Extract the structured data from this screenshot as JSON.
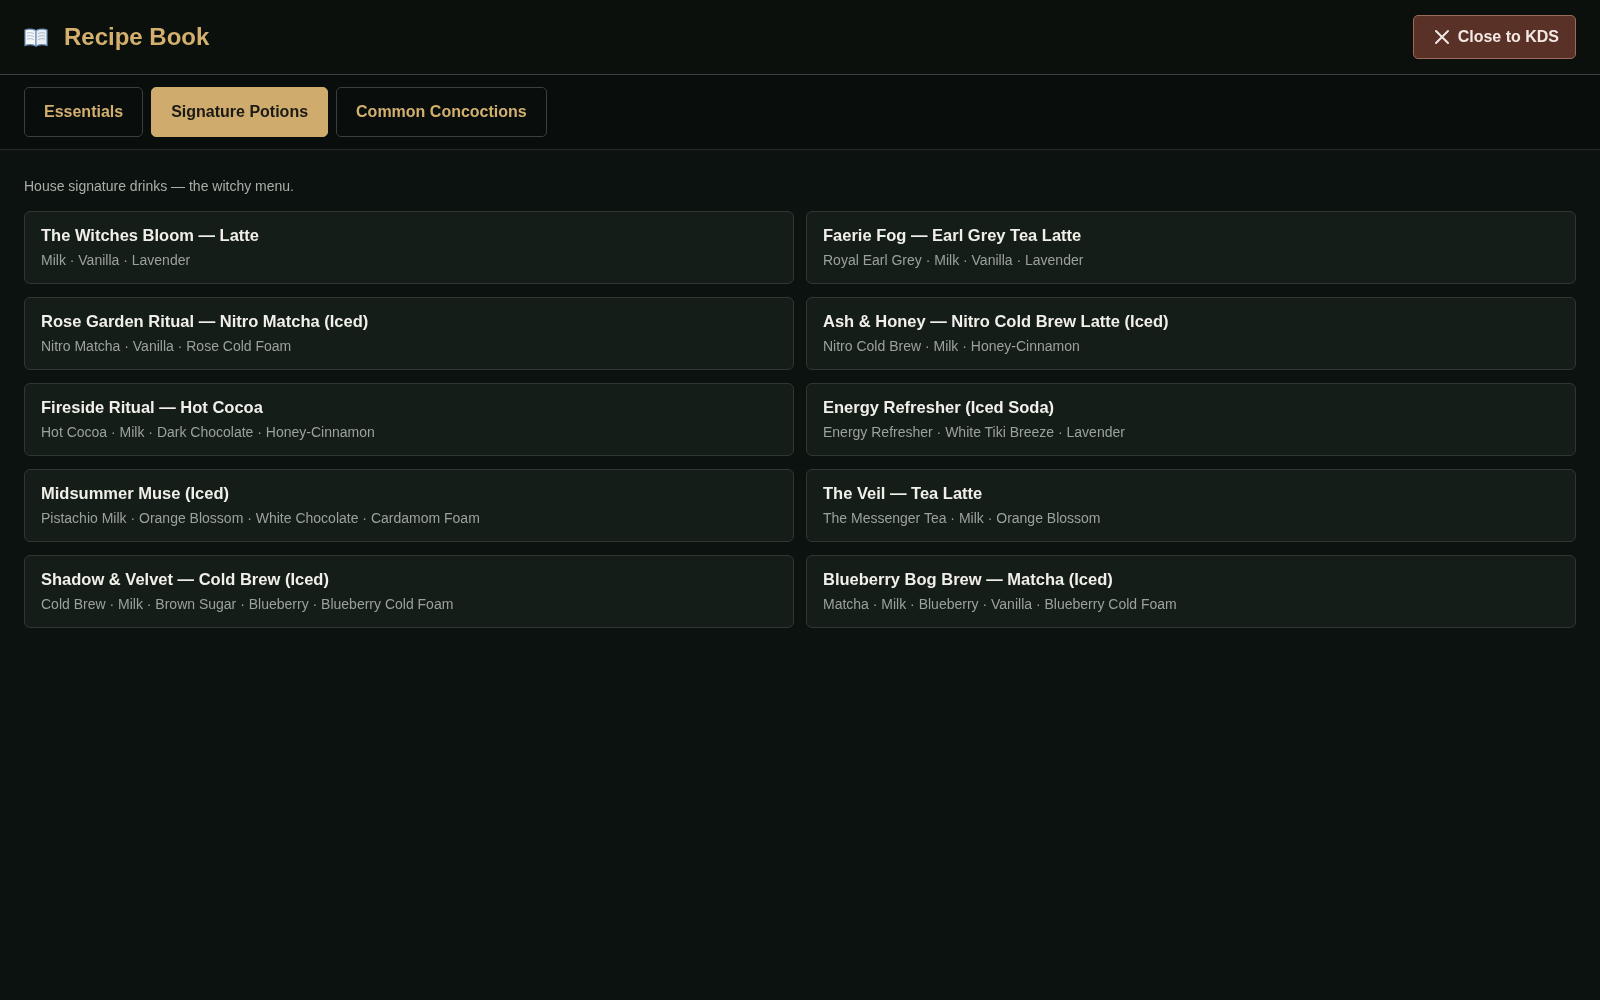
{
  "header": {
    "title": "Recipe Book",
    "close_button": "Close to KDS"
  },
  "tabs": [
    {
      "label": "Essentials",
      "selected": false
    },
    {
      "label": "Signature Potions",
      "selected": true
    },
    {
      "label": "Common Concoctions",
      "selected": false
    }
  ],
  "description": "House signature drinks — the witchy menu.",
  "recipes": [
    {
      "name": "The Witches Bloom — Latte",
      "ingredients": "Milk · Vanilla · Lavender"
    },
    {
      "name": "Faerie Fog — Earl Grey Tea Latte",
      "ingredients": "Royal Earl Grey · Milk · Vanilla · Lavender"
    },
    {
      "name": "Rose Garden Ritual — Nitro Matcha (Iced)",
      "ingredients": "Nitro Matcha · Vanilla · Rose Cold Foam"
    },
    {
      "name": "Ash & Honey — Nitro Cold Brew Latte (Iced)",
      "ingredients": "Nitro Cold Brew · Milk · Honey-Cinnamon"
    },
    {
      "name": "Fireside Ritual — Hot Cocoa",
      "ingredients": "Hot Cocoa · Milk · Dark Chocolate · Honey-Cinnamon"
    },
    {
      "name": "Energy Refresher (Iced Soda)",
      "ingredients": "Energy Refresher · White Tiki Breeze · Lavender"
    },
    {
      "name": "Midsummer Muse (Iced)",
      "ingredients": "Pistachio Milk · Orange Blossom · White Chocolate · Cardamom Foam"
    },
    {
      "name": "The Veil — Tea Latte",
      "ingredients": "The Messenger Tea · Milk · Orange Blossom"
    },
    {
      "name": "Shadow & Velvet — Cold Brew (Iced)",
      "ingredients": "Cold Brew · Milk · Brown Sugar · Blueberry · Blueberry Cold Foam"
    },
    {
      "name": "Blueberry Bog Brew — Matcha (Iced)",
      "ingredients": "Matcha · Milk · Blueberry · Vanilla · Blueberry Cold Foam"
    }
  ]
}
